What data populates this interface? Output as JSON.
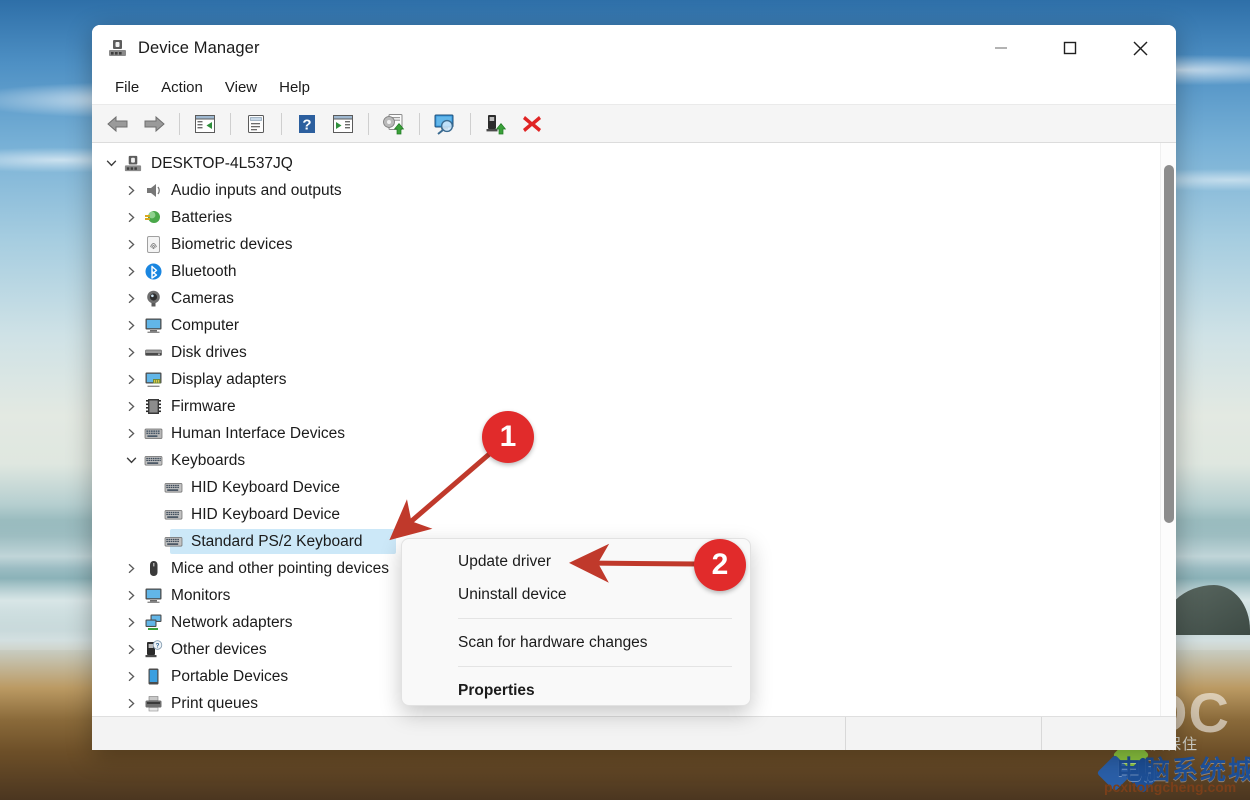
{
  "window": {
    "title": "Device Manager",
    "app_icon": "computer-device-icon",
    "controls": {
      "minimize": "minimize-icon",
      "maximize": "maximize-icon",
      "close": "close-icon"
    }
  },
  "menubar": {
    "items": [
      {
        "label": "File"
      },
      {
        "label": "Action"
      },
      {
        "label": "View"
      },
      {
        "label": "Help"
      }
    ]
  },
  "toolbar": {
    "buttons": [
      {
        "name": "back-button",
        "icon": "arrow-left-icon"
      },
      {
        "name": "forward-button",
        "icon": "arrow-right-icon"
      },
      {
        "name": "show-hide-console-tree-button",
        "icon": "console-tree-icon"
      },
      {
        "name": "properties-button",
        "icon": "properties-document-icon"
      },
      {
        "name": "help-button",
        "icon": "question-mark-icon"
      },
      {
        "name": "show-hide-action-pane-button",
        "icon": "action-pane-icon"
      },
      {
        "name": "update-driver-button",
        "icon": "update-driver-icon"
      },
      {
        "name": "scan-for-hardware-changes-button",
        "icon": "scan-monitor-icon"
      },
      {
        "name": "enable-device-button",
        "icon": "enable-device-icon"
      },
      {
        "name": "uninstall-device-button",
        "icon": "red-x-icon"
      }
    ]
  },
  "tree": {
    "root": {
      "label": "DESKTOP-4L537JQ",
      "expanded": true,
      "icon": "computer-device-icon"
    },
    "nodes": [
      {
        "label": "Audio inputs and outputs",
        "icon": "speaker-icon",
        "expanded": false,
        "indent": 1
      },
      {
        "label": "Batteries",
        "icon": "battery-icon",
        "expanded": false,
        "indent": 1
      },
      {
        "label": "Biometric devices",
        "icon": "fingerprint-icon",
        "expanded": false,
        "indent": 1
      },
      {
        "label": "Bluetooth",
        "icon": "bluetooth-icon",
        "expanded": false,
        "indent": 1
      },
      {
        "label": "Cameras",
        "icon": "camera-icon",
        "expanded": false,
        "indent": 1
      },
      {
        "label": "Computer",
        "icon": "monitor-icon",
        "expanded": false,
        "indent": 1
      },
      {
        "label": "Disk drives",
        "icon": "disk-drive-icon",
        "expanded": false,
        "indent": 1
      },
      {
        "label": "Display adapters",
        "icon": "display-adapter-icon",
        "expanded": false,
        "indent": 1
      },
      {
        "label": "Firmware",
        "icon": "firmware-chip-icon",
        "expanded": false,
        "indent": 1
      },
      {
        "label": "Human Interface Devices",
        "icon": "hid-keyboard-icon",
        "expanded": false,
        "indent": 1
      },
      {
        "label": "Keyboards",
        "icon": "keyboard-icon",
        "expanded": true,
        "indent": 1
      },
      {
        "label": "HID Keyboard Device",
        "icon": "keyboard-icon",
        "leaf": true,
        "indent": 2
      },
      {
        "label": "HID Keyboard Device",
        "icon": "keyboard-icon",
        "leaf": true,
        "indent": 2
      },
      {
        "label": "Standard PS/2 Keyboard",
        "icon": "keyboard-icon",
        "leaf": true,
        "indent": 2,
        "selected": true
      },
      {
        "label": "Mice and other pointing devices",
        "icon": "mouse-icon",
        "expanded": false,
        "indent": 1
      },
      {
        "label": "Monitors",
        "icon": "monitor-icon",
        "expanded": false,
        "indent": 1
      },
      {
        "label": "Network adapters",
        "icon": "network-adapter-icon",
        "expanded": false,
        "indent": 1
      },
      {
        "label": "Other devices",
        "icon": "unknown-device-icon",
        "expanded": false,
        "indent": 1
      },
      {
        "label": "Portable Devices",
        "icon": "portable-device-icon",
        "expanded": false,
        "indent": 1
      },
      {
        "label": "Print queues",
        "icon": "printer-icon",
        "expanded": false,
        "indent": 1
      },
      {
        "label": "",
        "icon": "",
        "expanded": false,
        "indent": 1
      }
    ],
    "selected_label": "Standard PS/2 Keyboard",
    "selection_color": "#cce8f8"
  },
  "context_menu": {
    "items": [
      {
        "label": "Update driver",
        "bold": false
      },
      {
        "label": "Uninstall device",
        "bold": false
      },
      {
        "label": "Scan for hardware changes",
        "bold": false
      },
      {
        "label": "Properties",
        "bold": true
      }
    ]
  },
  "statusbar": {
    "segments": [
      "",
      "",
      ""
    ]
  },
  "callouts": [
    {
      "number": "1",
      "color": "#e12b2b",
      "points_to": "Standard PS/2 Keyboard tree item"
    },
    {
      "number": "2",
      "color": "#e12b2b",
      "points_to": "Update driver menu item"
    }
  ],
  "watermark": {
    "large_letters": "DC",
    "tagline_zh": "质保住",
    "brand_zh": "电脑系统城",
    "url": "pcxitongcheng.com",
    "brand_color": "#1d4f96",
    "url_color": "#7a3f1a"
  },
  "scrollbar": {
    "orientation": "vertical",
    "thumb_color": "#8d8d8d"
  }
}
